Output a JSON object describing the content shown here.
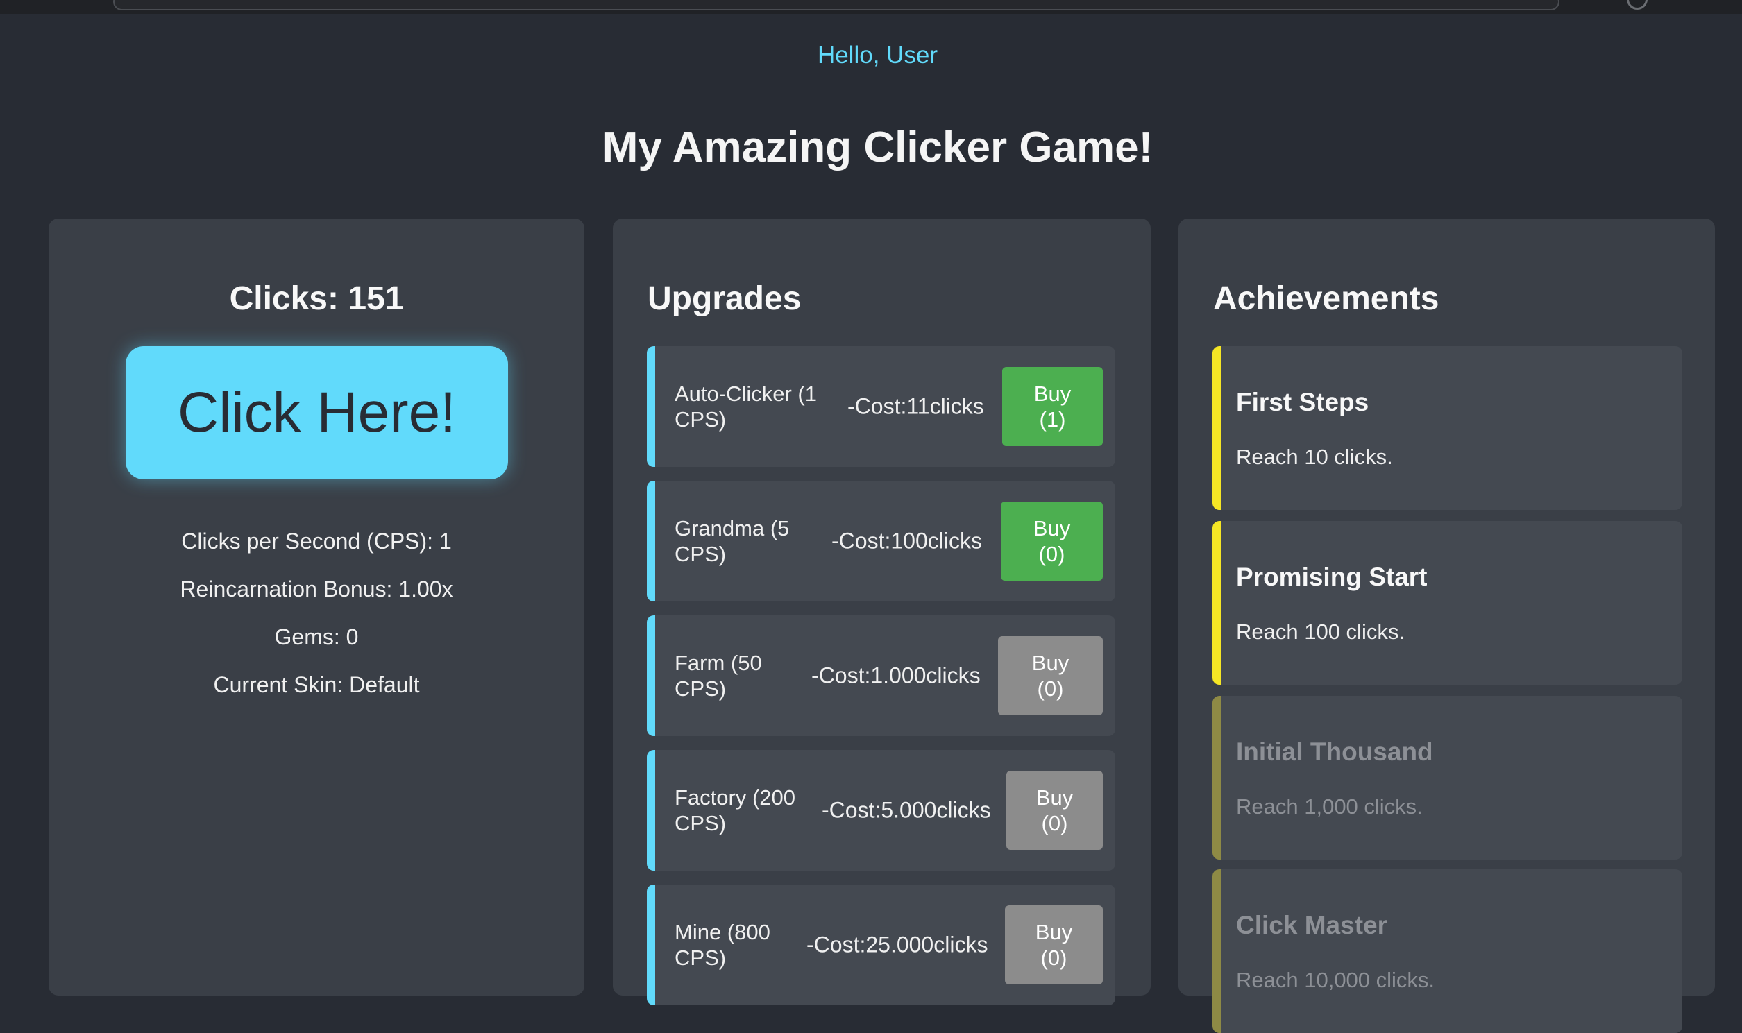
{
  "colors": {
    "background": "#282c34",
    "panel": "#3a3f47",
    "card": "#444951",
    "accent": "#61dafb",
    "buy_enabled": "#4caf50",
    "buy_disabled": "#8c8c8c",
    "achievement_unlocked": "#f5e625",
    "achievement_locked": "#8e8a45"
  },
  "header": {
    "greeting": "Hello, User",
    "title": "My Amazing Clicker Game!"
  },
  "clicker": {
    "clicks": "Clicks: 151",
    "button_label": "Click Here!",
    "cps": "Clicks per Second (CPS): 1",
    "reincarnation_bonus": "Reincarnation Bonus: 1.00x",
    "gems": "Gems: 0",
    "current_skin": "Current Skin: Default"
  },
  "upgrades": {
    "heading": "Upgrades",
    "items": [
      {
        "name": "Auto-Clicker (1 CPS)",
        "cost": "-Cost:11clicks",
        "buy_label": "Buy (1)",
        "enabled": true
      },
      {
        "name": "Grandma (5 CPS)",
        "cost": "-Cost:100clicks",
        "buy_label": "Buy (0)",
        "enabled": true
      },
      {
        "name": "Farm (50 CPS)",
        "cost": "-Cost:1.000clicks",
        "buy_label": "Buy (0)",
        "enabled": false
      },
      {
        "name": "Factory (200 CPS)",
        "cost": "-Cost:5.000clicks",
        "buy_label": "Buy (0)",
        "enabled": false
      },
      {
        "name": "Mine (800 CPS)",
        "cost": "-Cost:25.000clicks",
        "buy_label": "Buy (0)",
        "enabled": false
      }
    ]
  },
  "achievements": {
    "heading": "Achievements",
    "items": [
      {
        "name": "First Steps",
        "description": "Reach 10 clicks.",
        "unlocked": true
      },
      {
        "name": "Promising Start",
        "description": "Reach 100 clicks.",
        "unlocked": true
      },
      {
        "name": "Initial Thousand",
        "description": "Reach 1,000 clicks.",
        "unlocked": false
      },
      {
        "name": "Click Master",
        "description": "Reach 10,000 clicks.",
        "unlocked": false
      }
    ]
  }
}
